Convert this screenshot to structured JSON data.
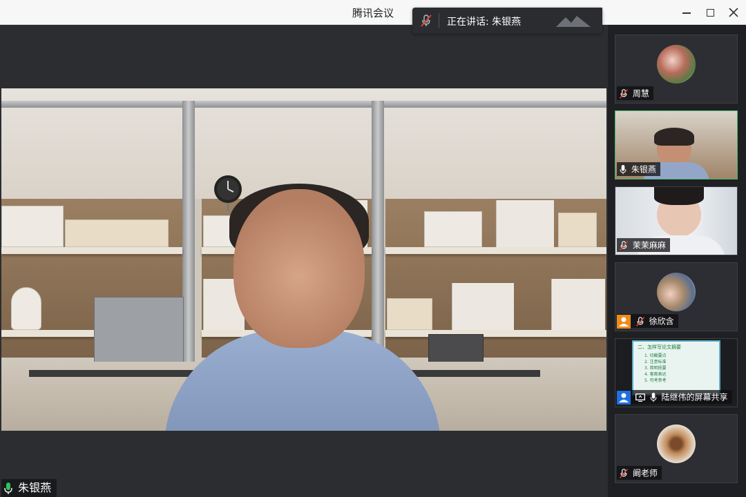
{
  "window": {
    "title": "腾讯会议"
  },
  "speaking_banner": {
    "text": "正在讲话: 朱银燕"
  },
  "main_video": {
    "speaker_name": "朱银燕"
  },
  "participants": [
    {
      "name": "周慧",
      "mic": "muted",
      "video": "avatar"
    },
    {
      "name": "朱银燕",
      "mic": "on",
      "video": "camera",
      "active": true
    },
    {
      "name": "茉茉麻麻",
      "mic": "muted",
      "video": "camera"
    },
    {
      "name": "徐欣含",
      "mic": "muted",
      "video": "avatar",
      "badge": "user-icon"
    },
    {
      "name": "陆继伟的屏幕共享",
      "mic": "on",
      "video": "screen-share",
      "badge": "user-icon"
    },
    {
      "name": "阚老师",
      "mic": "muted",
      "video": "avatar"
    }
  ],
  "screen_share_slide": {
    "heading": "二、怎样写论文摘要",
    "lines": [
      "1. 切截要点",
      "2. 注意标准",
      "3. 简明扼要",
      "4. 客观表达",
      "5. 可考参考"
    ]
  },
  "colors": {
    "active_tile_border": "#4ab86b",
    "mic_on": "#2fc15f",
    "badge_orange": "#f08a1c",
    "badge_blue": "#1f6fe0"
  }
}
